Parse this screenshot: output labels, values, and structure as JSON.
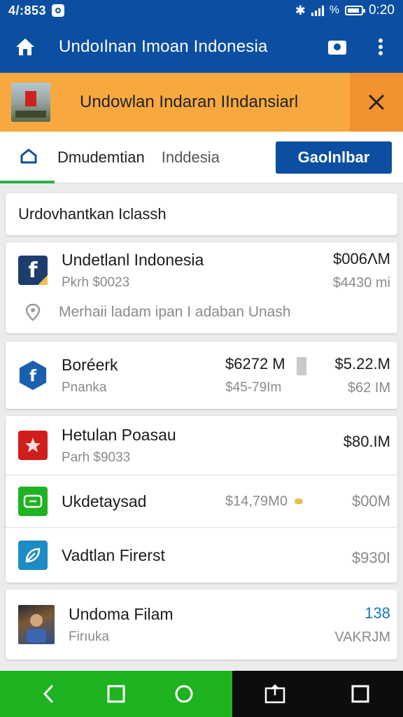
{
  "status": {
    "time_left": "4/:853",
    "battery_text": "%",
    "clock": "0:20"
  },
  "app_bar": {
    "title": "Undoılnan Imoan Indonesia"
  },
  "banner": {
    "text": "Undowlan Indaran IIndansiarl"
  },
  "tabs": {
    "active_label": "Dmudemtian",
    "second_label": "Inddesia",
    "button_label": "Gaolnlbar"
  },
  "section": {
    "title": "Urdovhantkan Iclassh"
  },
  "card1": {
    "name": "Undetlanl Indonesia",
    "sub": "Pkrh $0023",
    "amount_main": "$006ΛM",
    "amount_sub": "$4430 mi",
    "location": "Merhaii ladam ipan I adaban Unash"
  },
  "card2": {
    "name": "Boréerk",
    "sub": "Pnanka",
    "mid_main": "$6272 M",
    "mid_sub": "$45-79Im",
    "amount_main": "$5.22.M",
    "amount_sub": "$62 IM"
  },
  "card3": [
    {
      "name": "Hetulan Poasau",
      "sub": "Parh $9033",
      "amount_main": "$80.IM",
      "icon": "crest-icon",
      "color": "#d21d1d"
    },
    {
      "name": "Ukdetaysad",
      "mid": "$14,79M0",
      "amount_main": "$00M",
      "icon": "ticket-icon",
      "color": "#1fb221"
    },
    {
      "name": "Vadtlan Firerst",
      "amount_main": "$930I",
      "icon": "leaf-icon",
      "color": "#1d8cc4"
    }
  ],
  "card4": {
    "name": "Undoma Filam",
    "sub": "Firıuka",
    "amount_main": "138",
    "amount_sub": "VAKRJM"
  },
  "colors": {
    "primary": "#0c4fa2",
    "banner": "#f7a93f",
    "accent_green": "#1fb221",
    "link_blue": "#1877b8"
  }
}
